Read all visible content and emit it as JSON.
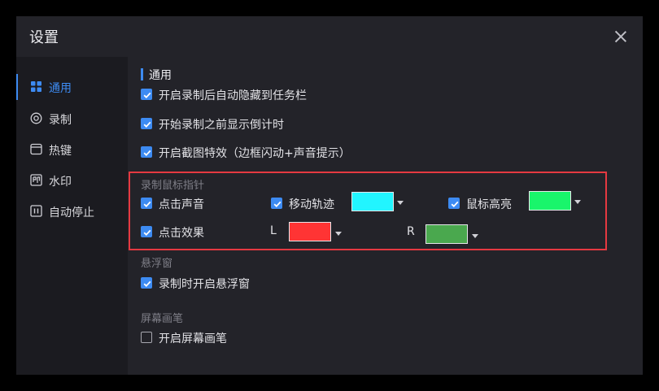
{
  "window": {
    "title": "设置"
  },
  "sidebar": {
    "items": [
      {
        "label": "通用",
        "icon": "grid-icon",
        "active": true
      },
      {
        "label": "录制",
        "icon": "record-icon",
        "active": false
      },
      {
        "label": "热键",
        "icon": "keyboard-icon",
        "active": false
      },
      {
        "label": "水印",
        "icon": "watermark-icon",
        "active": false
      },
      {
        "label": "自动停止",
        "icon": "auto-stop-icon",
        "active": false
      }
    ]
  },
  "general": {
    "heading": "通用",
    "options": [
      {
        "label": "开启录制后自动隐藏到任务栏",
        "checked": true
      },
      {
        "label": "开始录制之前显示倒计时",
        "checked": true
      },
      {
        "label": "开启截图特效（边框闪动+声音提示）",
        "checked": true
      }
    ]
  },
  "mouse": {
    "title": "录制鼠标指针",
    "click_sound": {
      "label": "点击声音",
      "checked": true
    },
    "move_track": {
      "label": "移动轨迹",
      "checked": true,
      "color": "#22f5ff"
    },
    "mouse_highlight": {
      "label": "鼠标高亮",
      "checked": true,
      "color": "#19f56b"
    },
    "click_effect": {
      "label": "点击效果",
      "checked": true
    },
    "left": {
      "label": "L",
      "color": "#ff3434"
    },
    "right": {
      "label": "R",
      "color": "#4aa84e"
    }
  },
  "floating": {
    "title": "悬浮窗",
    "option": {
      "label": "录制时开启悬浮窗",
      "checked": true
    }
  },
  "pen": {
    "title": "屏幕画笔",
    "option": {
      "label": "开启屏幕画笔",
      "checked": false
    }
  },
  "colors": {
    "accent": "#3d8bf2",
    "highlight_border": "#e53941",
    "bg": "#232329",
    "sidebar_bg": "#1b1b20"
  }
}
